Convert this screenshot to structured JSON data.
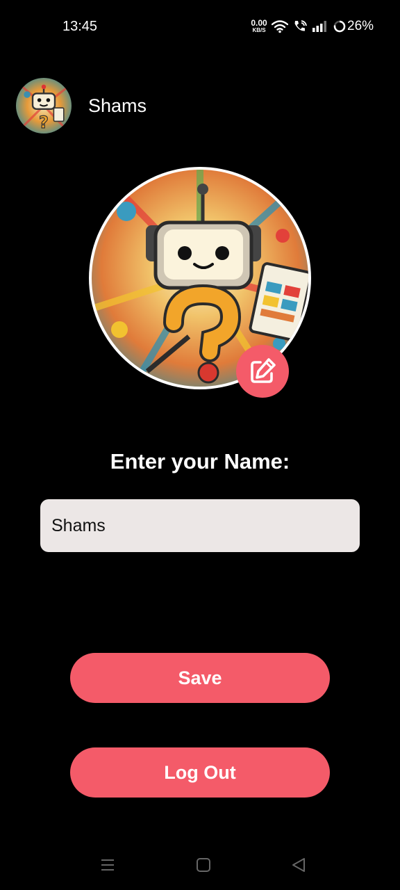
{
  "status_bar": {
    "time": "13:45",
    "net_speed_value": "0.00",
    "net_speed_unit": "KB/S",
    "battery_percent": "26%"
  },
  "header": {
    "username": "Shams"
  },
  "profile": {
    "name_label": "Enter your Name:",
    "name_value": "Shams"
  },
  "buttons": {
    "save_label": "Save",
    "logout_label": "Log Out"
  },
  "colors": {
    "accent": "#f45b69",
    "background": "#000000",
    "input_bg": "#ece7e6"
  },
  "icons": {
    "edit": "edit-square-pencil-icon",
    "nav_menu": "menu-icon",
    "nav_home": "home-square-icon",
    "nav_back": "back-triangle-icon"
  }
}
